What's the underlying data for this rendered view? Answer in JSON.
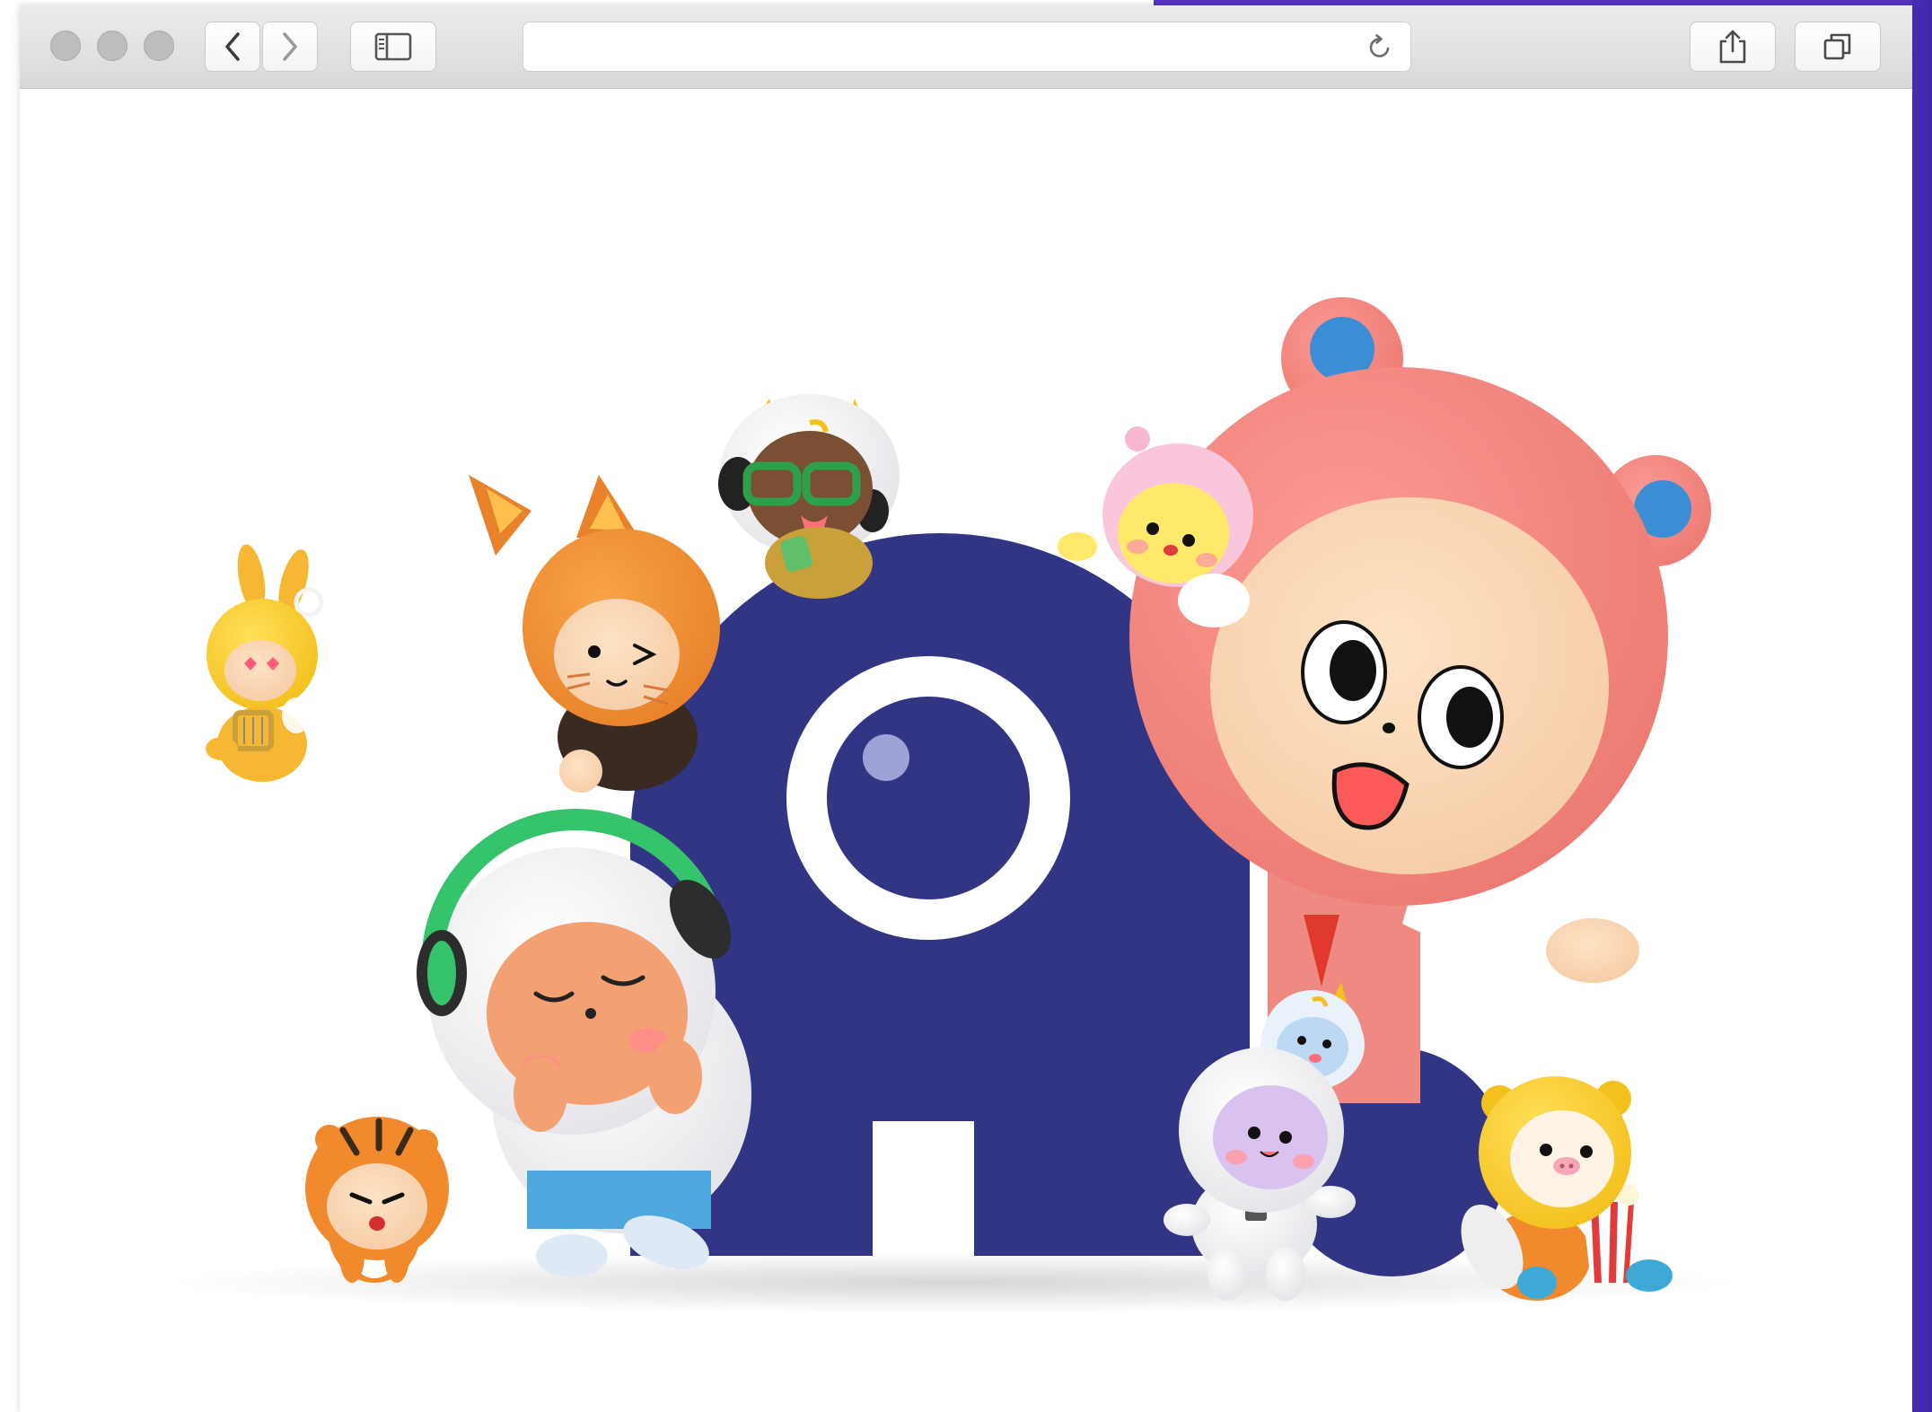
{
  "browser": {
    "back_icon": "chevron-left-icon",
    "forward_icon": "chevron-right-icon",
    "sidebar_icon": "sidebar-icon",
    "address_value": "",
    "reload_icon": "reload-icon",
    "share_icon": "share-icon",
    "tabs_icon": "tabs-icon"
  },
  "hero": {
    "logo_color": "#323584",
    "accent_color": "#5533c4"
  }
}
